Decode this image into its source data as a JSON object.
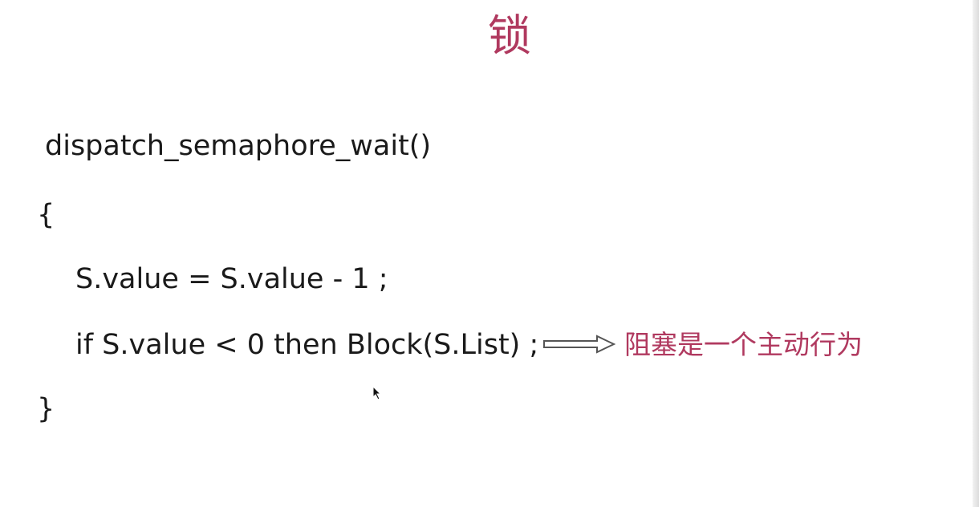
{
  "slide": {
    "title": "锁",
    "code_lines": [
      "dispatch_semaphore_wait()",
      "{",
      "S.value = S.value - 1 ;",
      "if S.value < 0 then Block(S.List) ;",
      "}"
    ],
    "annotation": "阻塞是一个主动行为",
    "arrow_icon": "hollow-right-arrow-icon",
    "cursor_icon": "mouse-pointer-icon"
  },
  "colors": {
    "accent": "#b0395f",
    "text": "#1a1a1a",
    "background": "#ffffff"
  }
}
